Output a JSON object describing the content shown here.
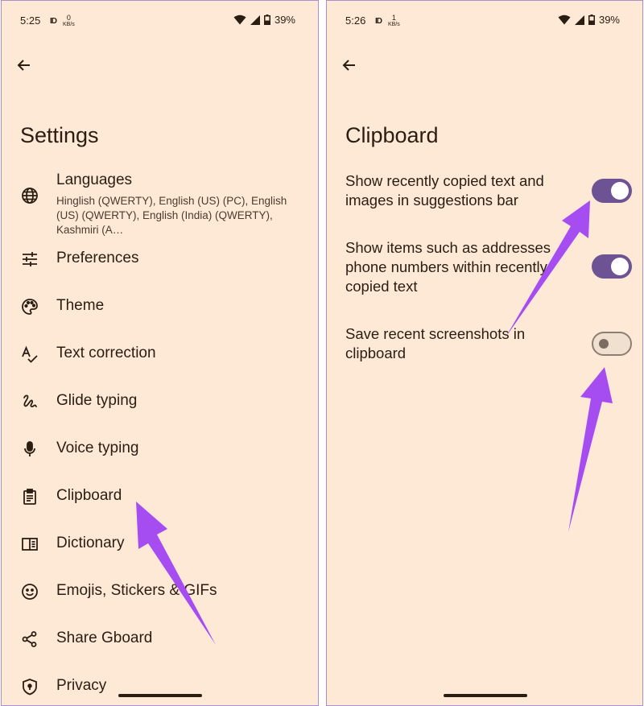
{
  "left_screen": {
    "status_bar": {
      "time": "5:25",
      "net_speed": "0",
      "net_unit": "KB/s",
      "battery": "39%"
    },
    "title": "Settings",
    "menu": [
      {
        "label": "Languages",
        "subtitle": "Hinglish (QWERTY), English (US) (PC), English (US) (QWERTY), English (India) (QWERTY), Kashmiri (A…",
        "icon": "globe-icon"
      },
      {
        "label": "Preferences",
        "icon": "sliders-icon"
      },
      {
        "label": "Theme",
        "icon": "palette-icon"
      },
      {
        "label": "Text correction",
        "icon": "spellcheck-icon"
      },
      {
        "label": "Glide typing",
        "icon": "gesture-icon"
      },
      {
        "label": "Voice typing",
        "icon": "microphone-icon"
      },
      {
        "label": "Clipboard",
        "icon": "clipboard-icon"
      },
      {
        "label": "Dictionary",
        "icon": "book-icon"
      },
      {
        "label": "Emojis, Stickers & GIFs",
        "icon": "emoji-icon"
      },
      {
        "label": "Share Gboard",
        "icon": "share-icon"
      },
      {
        "label": "Privacy",
        "icon": "shield-icon"
      }
    ]
  },
  "right_screen": {
    "status_bar": {
      "time": "5:26",
      "net_speed": "1",
      "net_unit": "KB/s",
      "battery": "39%"
    },
    "title": "Clipboard",
    "settings": [
      {
        "label": "Show recently copied text and images in suggestions bar",
        "enabled": true
      },
      {
        "label": "Show items such as addresses phone numbers within recently copied text",
        "enabled": true
      },
      {
        "label": "Save recent screenshots in clipboard",
        "enabled": false
      }
    ]
  },
  "colors": {
    "background": "#fde9d6",
    "text": "#2a1d12",
    "toggle_on": "#6d5394",
    "annotation_arrow": "#a64df2"
  }
}
